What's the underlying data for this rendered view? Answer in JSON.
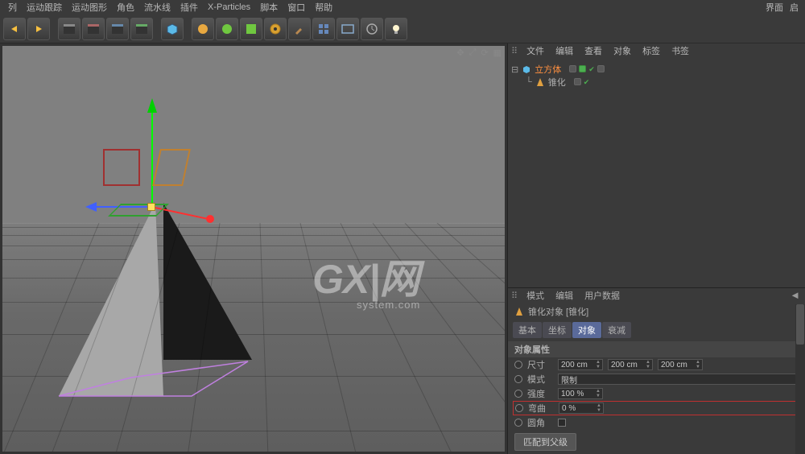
{
  "menu": {
    "items": [
      "列",
      "运动跟踪",
      "运动图形",
      "角色",
      "流水线",
      "插件",
      "X-Particles",
      "脚本",
      "窗口",
      "帮助"
    ],
    "right": [
      "界面",
      "启"
    ]
  },
  "objects_panel": {
    "tabs": [
      "文件",
      "编辑",
      "查看",
      "对象",
      "标签",
      "书签"
    ],
    "tree": [
      {
        "icon": "cube",
        "label": "立方体",
        "selected": true,
        "expand": "minus"
      },
      {
        "icon": "cone",
        "label": "锥化",
        "indent": 1
      }
    ]
  },
  "attr_panel": {
    "tabs": [
      "模式",
      "编辑",
      "用户数据"
    ],
    "title": "锥化对象 [锥化]",
    "mode_tabs": [
      "基本",
      "坐标",
      "对象",
      "衰减"
    ],
    "active_mode": 2,
    "section": "对象属性",
    "rows": {
      "size_label": "尺寸",
      "size_x": "200 cm",
      "size_y": "200 cm",
      "size_z": "200 cm",
      "mode_label": "模式",
      "mode_value": "限制",
      "strength_label": "强度",
      "strength_value": "100 %",
      "curve_label": "弯曲",
      "curve_value": "0 %",
      "fillet_label": "圆角",
      "fillet_value": ""
    },
    "button": "匹配到父级"
  },
  "watermark": {
    "big": "GX|网",
    "small": "system.com"
  }
}
